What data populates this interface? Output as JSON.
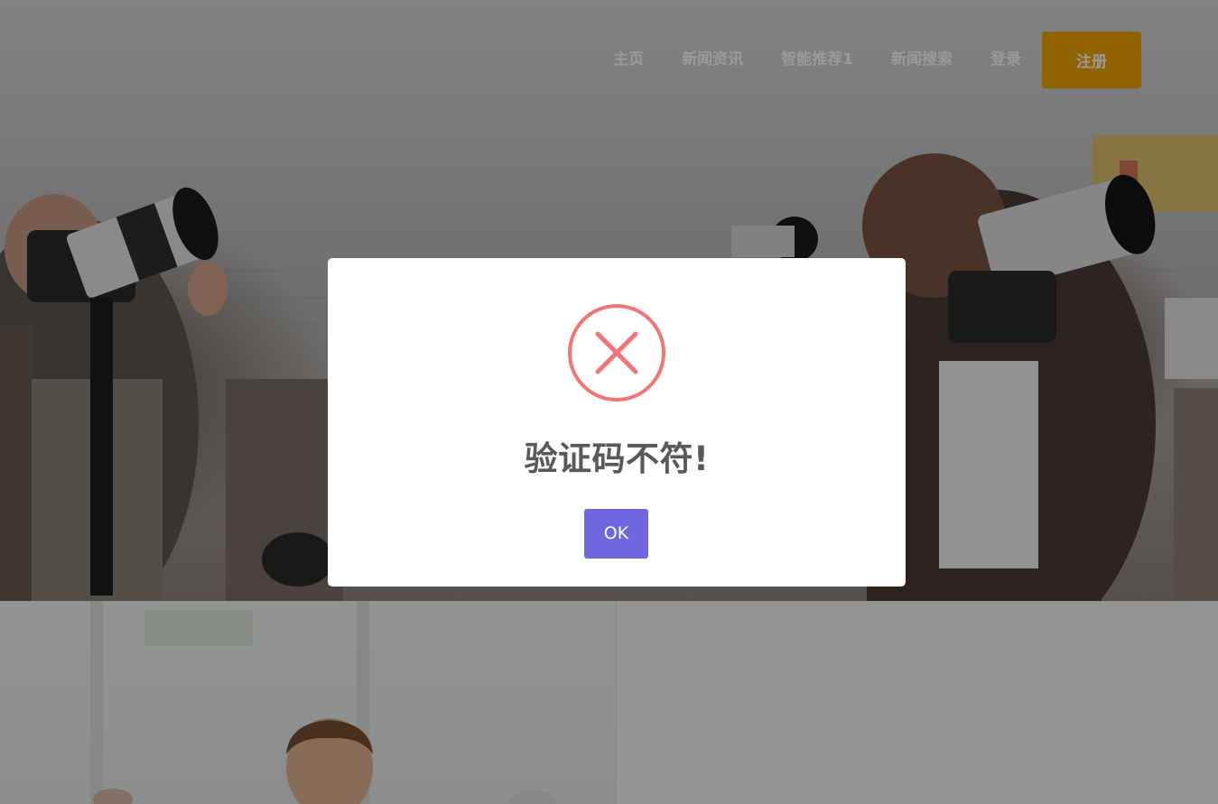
{
  "nav": {
    "items": [
      {
        "label": "主页"
      },
      {
        "label": "新闻资讯"
      },
      {
        "label": "智能推荐1"
      },
      {
        "label": "新闻搜索"
      },
      {
        "label": "登录"
      }
    ],
    "cta_label": "注册"
  },
  "dialog": {
    "icon": "error-x-icon",
    "title": "验证码不符!",
    "ok_label": "OK"
  },
  "colors": {
    "cta": "#f0a500",
    "ok_button": "#7066e0",
    "error_icon": "#f27474",
    "title_text": "#595959"
  }
}
